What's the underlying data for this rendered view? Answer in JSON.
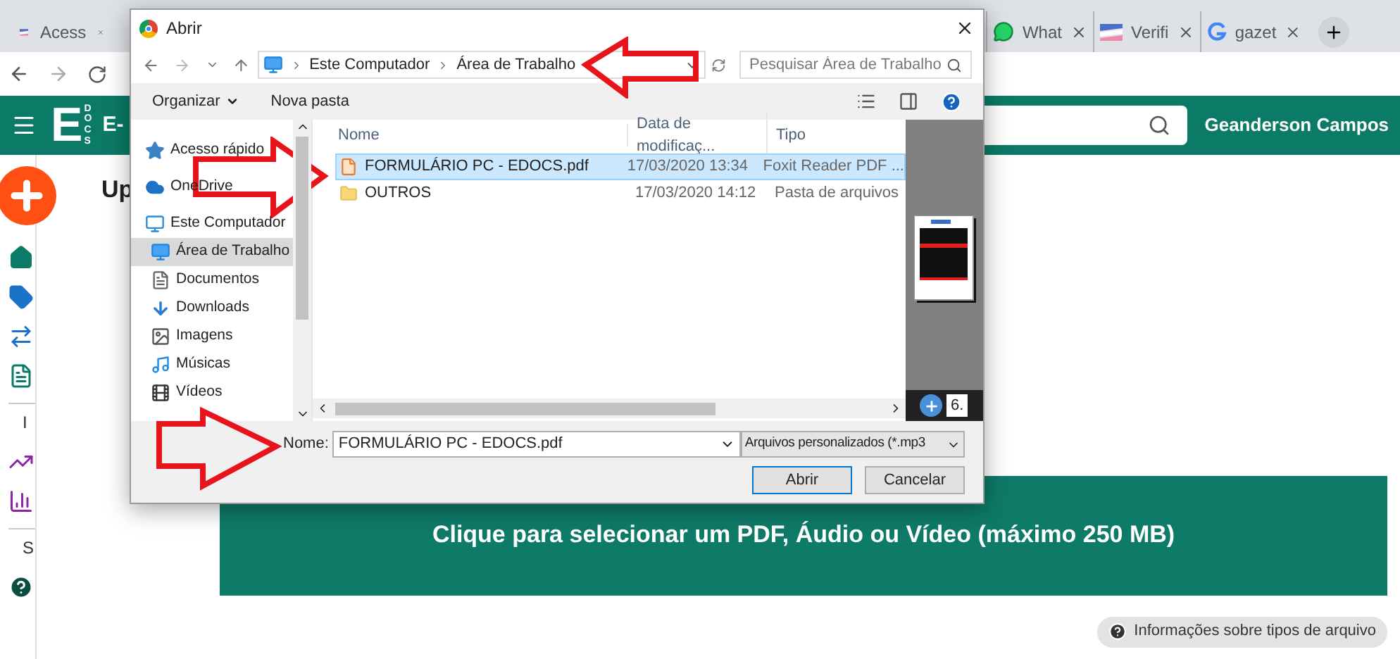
{
  "browser": {
    "tabs": [
      {
        "title": "Acess",
        "kind": "flag"
      },
      {
        "title": "What",
        "kind": "chat"
      },
      {
        "title": "Verifi",
        "kind": "flag"
      },
      {
        "title": "gazet",
        "kind": "google"
      }
    ]
  },
  "header": {
    "logo_letter": "E",
    "logo_sub": "DOCS",
    "app_name": "E-",
    "user": "Geanderson Campos"
  },
  "sidebar": {
    "items": [
      {
        "kind": "add"
      },
      {
        "kind": "home"
      },
      {
        "kind": "tag"
      },
      {
        "kind": "transfer"
      },
      {
        "kind": "document"
      },
      {
        "kind": "section",
        "label": "I"
      },
      {
        "kind": "trend"
      },
      {
        "kind": "bars"
      },
      {
        "kind": "section",
        "label": "S"
      },
      {
        "kind": "help"
      }
    ]
  },
  "page": {
    "heading": "Up",
    "dropzone": "Clique para selecionar um PDF, Áudio ou Vídeo (máximo 250 MB)",
    "info": "Informações sobre tipos de arquivo"
  },
  "dialog": {
    "title": "Abrir",
    "breadcrumb": [
      "Este Computador",
      "Área de Trabalho"
    ],
    "search": {
      "placeholder": "Pesquisar Área de Trabalho"
    },
    "toolbar": [
      "Organizar",
      "Nova pasta"
    ],
    "nav": [
      {
        "label": "Acesso rápido",
        "kind": "star",
        "selected": false
      },
      {
        "label": "OneDrive",
        "kind": "cloud",
        "selected": false
      },
      {
        "label": "Este Computador",
        "kind": "computer",
        "selected": false,
        "children": [
          {
            "label": "Área de Trabalho",
            "kind": "desktop",
            "selected": true
          },
          {
            "label": "Documentos",
            "kind": "docs",
            "selected": false
          },
          {
            "label": "Downloads",
            "kind": "download",
            "selected": false
          },
          {
            "label": "Imagens",
            "kind": "image",
            "selected": false
          },
          {
            "label": "Músicas",
            "kind": "music",
            "selected": false
          },
          {
            "label": "Vídeos",
            "kind": "video",
            "selected": false
          }
        ]
      }
    ],
    "columns": [
      "Nome",
      "Data de modificaç...",
      "Tipo"
    ],
    "rows": [
      {
        "name": "FORMULÁRIO PC - EDOCS.pdf",
        "date": "17/03/2020 13:34",
        "type": "Foxit Reader PDF ...",
        "kind": "pdf",
        "selected": true
      },
      {
        "name": "OUTROS",
        "date": "17/03/2020 14:12",
        "type": "Pasta de arquivos",
        "kind": "folder",
        "selected": false
      }
    ],
    "preview": {
      "zoom_value": "6."
    },
    "name_label": "Nome:",
    "name_value": "FORMULÁRIO PC - EDOCS.pdf",
    "filetype": "Arquivos personalizados (*.mp3",
    "buttons": [
      "Abrir",
      "Cancelar"
    ]
  }
}
